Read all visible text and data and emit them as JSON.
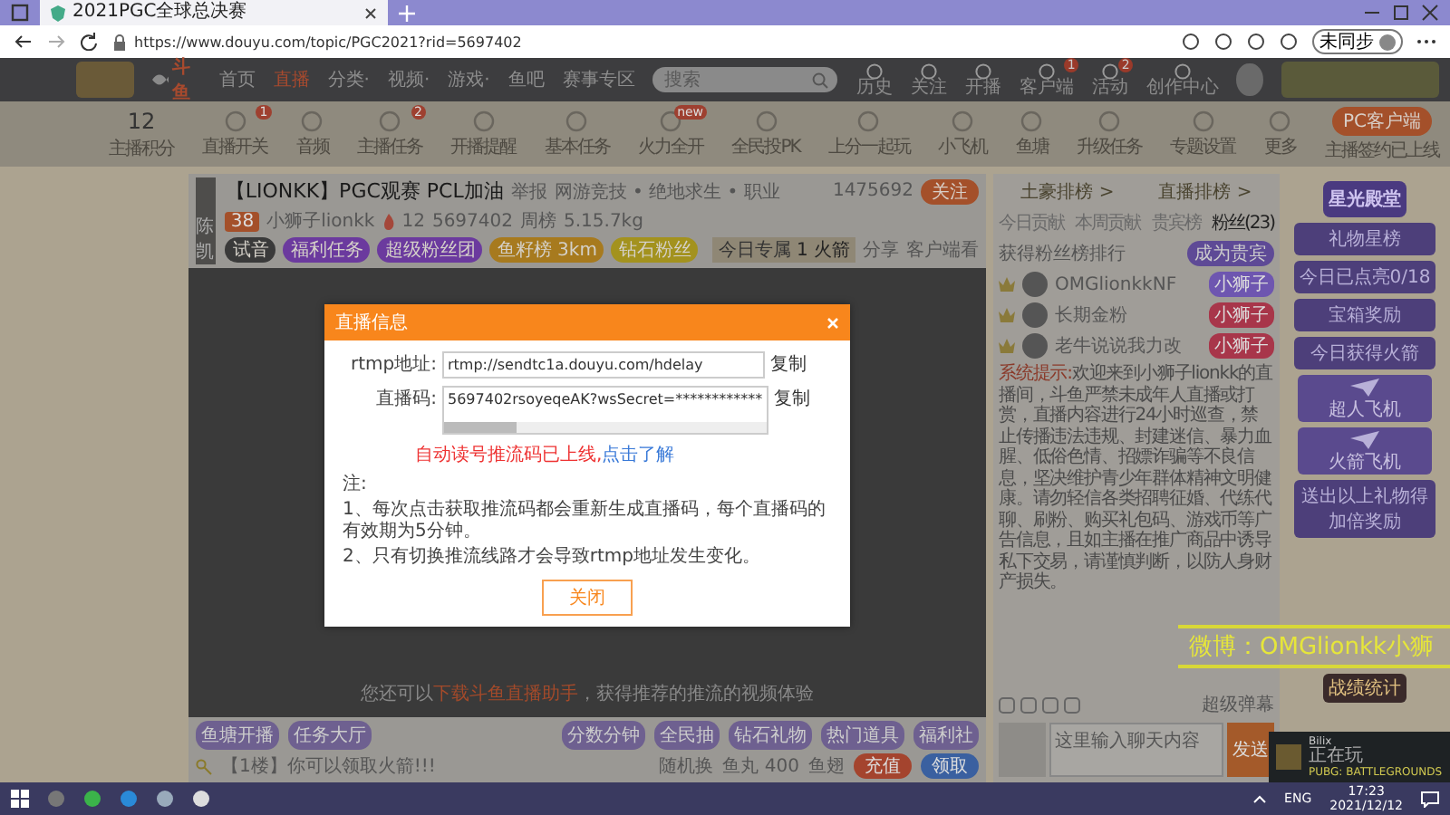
{
  "browser": {
    "tab_title": "2021PGC全球总决赛",
    "url": "https://www.douyu.com/topic/PGC2021?rid=5697402",
    "profile_label": "未同步"
  },
  "site_nav": {
    "logo": "斗鱼",
    "items": [
      {
        "label": "首页",
        "selected": false
      },
      {
        "label": "直播",
        "selected": true
      },
      {
        "label": "分类·",
        "selected": false
      },
      {
        "label": "视频·",
        "selected": false
      },
      {
        "label": "游戏·",
        "selected": false
      },
      {
        "label": "鱼吧",
        "selected": false
      },
      {
        "label": "赛事专区",
        "selected": false
      }
    ],
    "search": {
      "placeholder": "搜索"
    },
    "actions": [
      {
        "label": "历史"
      },
      {
        "label": "关注"
      },
      {
        "label": "开播"
      },
      {
        "label": "客户端",
        "badge": "1"
      },
      {
        "label": "活动",
        "badge": "2"
      },
      {
        "label": "创作中心"
      }
    ]
  },
  "anchor_bar": {
    "score": {
      "value": "12",
      "label": "主播积分"
    },
    "tools": [
      {
        "label": "直播开关",
        "badge": "1"
      },
      {
        "label": "音频"
      },
      {
        "label": "主播任务",
        "badge": "2"
      },
      {
        "label": "开播提醒"
      },
      {
        "label": "基本任务"
      },
      {
        "label": "火力全开",
        "badge": "new"
      },
      {
        "label": "全民投PK"
      },
      {
        "label": "上分一起玩"
      },
      {
        "label": "小飞机"
      },
      {
        "label": "鱼塘"
      },
      {
        "label": "升级任务"
      },
      {
        "label": "专题设置"
      },
      {
        "label": "更多"
      }
    ],
    "client_button": "PC客户端",
    "client_note": "主播签约已上线"
  },
  "stream": {
    "title": "【LIONKK】PGC观赛 PCL加油",
    "report": "举报",
    "category": "网游竞技 • 绝地求生 • 职业",
    "level": "38",
    "anchor": "小狮子lionkk",
    "hot": "12",
    "room": "5697402",
    "rank": "周榜",
    "weight": "5.15.7kg",
    "badges": [
      {
        "label": "试音",
        "color": "#3a3a3a"
      },
      {
        "label": "福利任务",
        "color": "#6b3a9e"
      },
      {
        "label": "超级粉丝团",
        "color": "#6b3a9e"
      },
      {
        "label": "鱼籽榜 3km",
        "color": "#a77a1e"
      },
      {
        "label": "钻石粉丝",
        "color": "#a3921e"
      }
    ],
    "followers": "1475692",
    "follow_button": "关注",
    "today_label": "今日专属",
    "today_value": "1 火箭",
    "share": "分享",
    "client_watch": "客户端看",
    "avatar_caption": "陈凯"
  },
  "video": {
    "hint_before": "您还可以",
    "hint_link": "下载斗鱼直播助手",
    "hint_after": "，获得推荐的推流的视频体验"
  },
  "dialog": {
    "title": "直播信息",
    "rtmp_label": "rtmp地址:",
    "rtmp_value": "rtmp://sendtc1a.douyu.com/hdelay",
    "copy1": "复制",
    "code_label": "直播码:",
    "code_value": "5697402rsoyeqeAK?wsSecret=************",
    "copy2": "复制",
    "warning": "自动读号推流码已上线,",
    "learn_more": "点击了解",
    "note_title": "注:",
    "notes": [
      "1、每次点击获取推流码都会重新生成直播码，每个直播码的有效期为5分钟。",
      "2、只有切换推流线路才会导致rtmp地址发生变化。"
    ],
    "close_button": "关闭"
  },
  "gift_bar": {
    "left_gifts": [
      "鱼塘开播",
      "任务大厅"
    ],
    "right_gifts": [
      "分数分钟",
      "全民抽",
      "钻石礼物",
      "热门道具",
      "福利社"
    ],
    "notice": "【1楼】你可以领取火箭!!!",
    "random": "随机换",
    "fish_balls": "鱼丸 400",
    "fish_fin": "鱼翅",
    "recharge": "充值",
    "claim": "领取"
  },
  "chat": {
    "rank_links": [
      "土豪排榜 >",
      "直播排榜 >"
    ],
    "tabs": [
      {
        "label": "今日贡献",
        "selected": false
      },
      {
        "label": "本周贡献",
        "selected": false
      },
      {
        "label": "贵宾榜",
        "selected": false
      },
      {
        "label": "粉丝(23)",
        "selected": true
      }
    ],
    "fan_header": "获得粉丝榜排行",
    "become_vip": "成为贵宾",
    "fans": [
      {
        "name": "OMGlionkkNF",
        "tag": "小狮子",
        "color": "#6e56b0"
      },
      {
        "name": "长期金粉",
        "tag": "小狮子",
        "color": "#a8364a"
      },
      {
        "name": "老牛说说我力改",
        "tag": "小狮子",
        "color": "#a8364a"
      }
    ],
    "notice_label": "系统提示:",
    "notice": "欢迎来到小狮子lionkk的直播间，斗鱼严禁未成年人直播或打赏，直播内容进行24小时巡查，禁止传播违法违规、封建迷信、暴力血腥、低俗色情、招嫖诈骗等不良信息，坚决维护青少年群体精神文明健康。请勿轻信各类招聘征婚、代练代聊、刷粉、购买礼包码、游戏币等广告信息，且如主播在推广商品中诱导私下交易，请谨慎判断，以防人身财产损失。",
    "input_placeholder": "这里输入聊天内容",
    "expand": "超级弹幕",
    "send": "发送"
  },
  "sidebar": {
    "title": "星光殿堂",
    "sections": [
      "礼物星榜",
      "今日已点亮0/18",
      "宝箱奖励",
      "今日获得火箭"
    ],
    "items": [
      "超人飞机",
      "火箭飞机"
    ],
    "footer": "送出以上礼物得加倍奖励",
    "stats_badge": "战绩统计"
  },
  "danmaku": "微博：OMGlionkk小狮",
  "toast": {
    "user": "Bilix",
    "action": "正在玩",
    "game": "PUBG: BATTLEGROUNDS"
  },
  "taskbar": {
    "lang": "ENG",
    "time": "17:23",
    "date": "2021/12/12"
  }
}
